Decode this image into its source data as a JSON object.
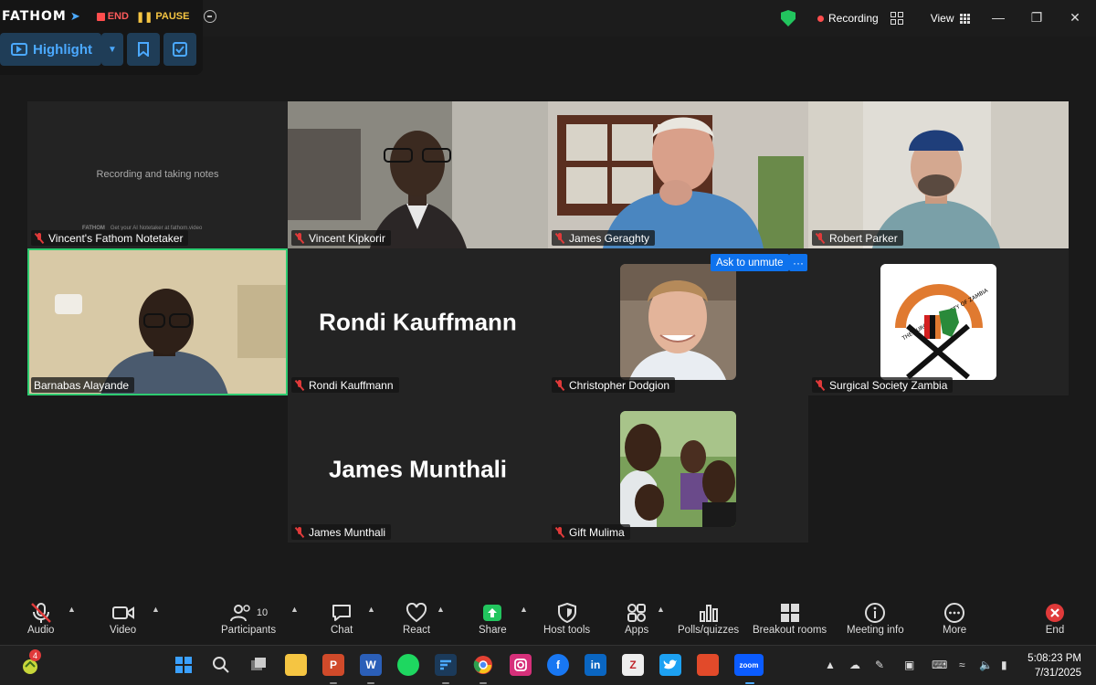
{
  "fathom": {
    "logo": "FATHOM",
    "end_label": "END",
    "pause_label": "PAUSE",
    "highlight_label": "Highlight"
  },
  "header": {
    "recording_label": "Recording",
    "view_label": "View"
  },
  "participants": [
    {
      "name": "Vincent's Fathom Notetaker",
      "muted": true,
      "kind": "notetaker"
    },
    {
      "name": "Vincent Kipkorir",
      "muted": true,
      "kind": "video"
    },
    {
      "name": "James Geraghty",
      "muted": true,
      "kind": "video"
    },
    {
      "name": "Robert Parker",
      "muted": true,
      "kind": "video"
    },
    {
      "name": "Barnabas Alayande",
      "muted": false,
      "kind": "video",
      "active": true
    },
    {
      "name": "Rondi Kauffmann",
      "muted": true,
      "kind": "name-only"
    },
    {
      "name": "Christopher Dodgion",
      "muted": true,
      "kind": "avatar"
    },
    {
      "name": "Surgical Society Zambia",
      "muted": true,
      "kind": "logo"
    },
    {
      "name": "James Munthali",
      "muted": true,
      "kind": "name-only"
    },
    {
      "name": "Gift Mulima",
      "muted": true,
      "kind": "avatar"
    }
  ],
  "notetaker": {
    "status_text": "Recording and taking notes",
    "footer_logo": "FATHOM",
    "footer_text": "Get your AI Notetaker at fathom.video"
  },
  "ask_to_unmute": "Ask to unmute",
  "ask_more": "···",
  "logo_ring_text": "THE SURGICAL SOCIETY OF ZAMBIA",
  "toolbar": {
    "audio": "Audio",
    "video": "Video",
    "participants": "Participants",
    "participants_count": "10",
    "chat": "Chat",
    "react": "React",
    "share": "Share",
    "host_tools": "Host tools",
    "apps": "Apps",
    "polls": "Polls/quizzes",
    "breakout": "Breakout rooms",
    "meeting_info": "Meeting info",
    "more": "More",
    "end": "End"
  },
  "taskbar": {
    "notification_count": "4",
    "time": "5:08:23 PM",
    "date": "7/31/2025",
    "apps": [
      "windows-start",
      "search",
      "task-view",
      "file-explorer",
      "powerpoint",
      "word",
      "spotify",
      "fathom",
      "chrome",
      "instagram",
      "facebook",
      "linkedin",
      "zotero",
      "twitter",
      "acrobat",
      "zoom"
    ],
    "app_labels": {
      "powerpoint": "P",
      "word": "W",
      "linkedin": "in",
      "zotero": "Z",
      "facebook": "f",
      "zoom": "zoom"
    }
  },
  "colors": {
    "active_speaker": "#2ecc71",
    "unmute_button": "#0e72ed",
    "muted_icon": "#e03a3a",
    "fathom_accent": "#4ba9ff",
    "shield": "#22c55e"
  }
}
